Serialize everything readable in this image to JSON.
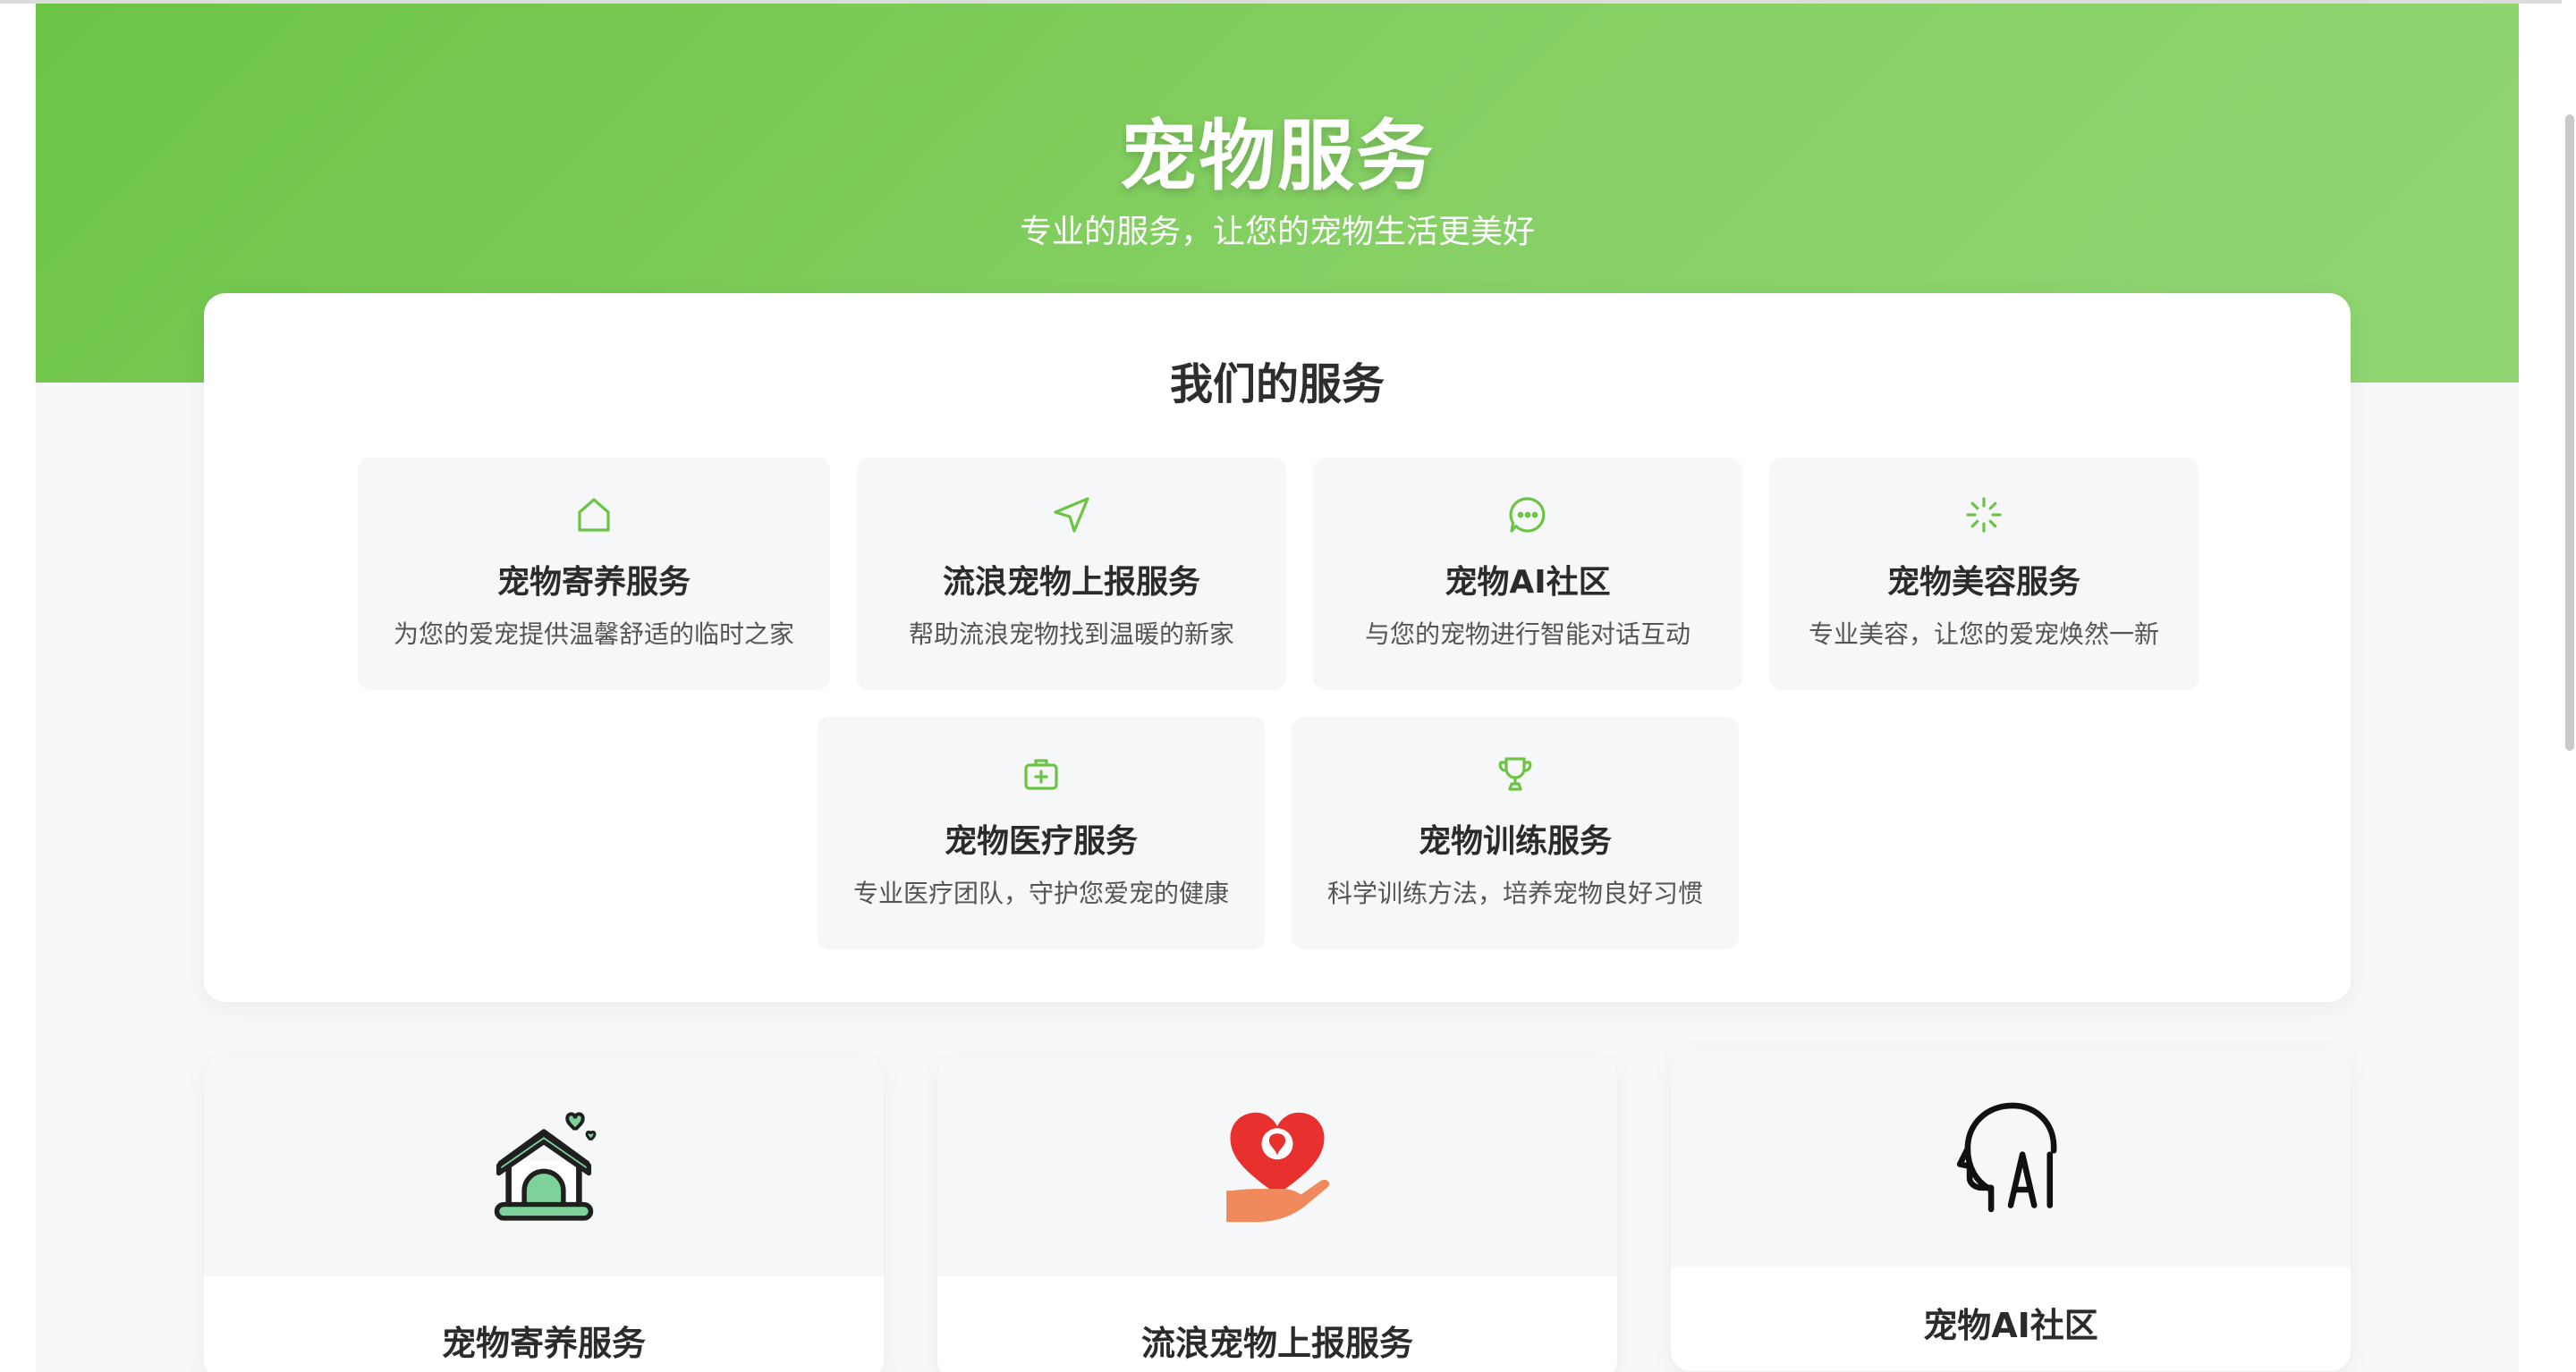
{
  "hero": {
    "title": "宠物服务",
    "subtitle": "专业的服务，让您的宠物生活更美好"
  },
  "services": {
    "heading": "我们的服务",
    "items": [
      {
        "title": "宠物寄养服务",
        "desc": "为您的爱宠提供温馨舒适的临时之家",
        "icon": "home-icon"
      },
      {
        "title": "流浪宠物上报服务",
        "desc": "帮助流浪宠物找到温暖的新家",
        "icon": "navigation-icon"
      },
      {
        "title": "宠物AI社区",
        "desc": "与您的宠物进行智能对话互动",
        "icon": "chat-icon"
      },
      {
        "title": "宠物美容服务",
        "desc": "专业美容，让您的爱宠焕然一新",
        "icon": "sparkle-icon"
      },
      {
        "title": "宠物医疗服务",
        "desc": "专业医疗团队，守护您爱宠的健康",
        "icon": "medical-kit-icon"
      },
      {
        "title": "宠物训练服务",
        "desc": "科学训练方法，培养宠物良好习惯",
        "icon": "trophy-icon"
      }
    ]
  },
  "features": [
    {
      "title": "宠物寄养服务",
      "icon": "pet-house-icon"
    },
    {
      "title": "流浪宠物上报服务",
      "icon": "heart-hand-icon"
    },
    {
      "title": "宠物AI社区",
      "icon": "ai-head-icon"
    }
  ],
  "colors": {
    "accent": "#6cc445",
    "card_bg": "#f6f7f9",
    "heart_red": "#e8312f",
    "hand_orange": "#f08a5d"
  }
}
